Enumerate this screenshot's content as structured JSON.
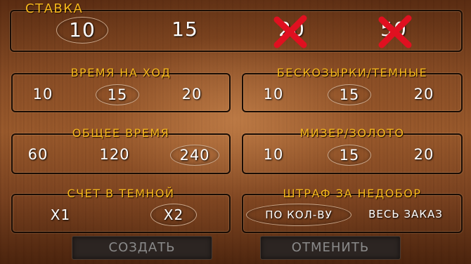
{
  "stake": {
    "title": "СТАВКА",
    "options": [
      "10",
      "15",
      "20",
      "50"
    ]
  },
  "move_time": {
    "title": "ВРЕМЯ НА ХОД",
    "options": [
      "10",
      "15",
      "20"
    ]
  },
  "no_trump_dark": {
    "title": "БЕСКОЗЫРКИ/ТЕМНЫЕ",
    "options": [
      "10",
      "15",
      "20"
    ]
  },
  "total_time": {
    "title": "ОБЩЕЕ ВРЕМЯ",
    "options": [
      "60",
      "120",
      "240"
    ]
  },
  "misere_gold": {
    "title": "МИЗЕР/ЗОЛОТО",
    "options": [
      "10",
      "15",
      "20"
    ]
  },
  "dark_score": {
    "title": "СЧЕТ В ТЕМНОЙ",
    "options": [
      "X1",
      "X2"
    ]
  },
  "penalty": {
    "title": "ШТРАФ ЗА НЕДОБОР",
    "options": [
      "ПО КОЛ-ВУ",
      "ВЕСЬ ЗАКАЗ"
    ]
  },
  "buttons": {
    "create": "СОЗДАТЬ",
    "cancel": "ОТМЕНИТЬ"
  },
  "colors": {
    "title": "#f5b81c",
    "disabled_cross": "#e01020",
    "selection_ring": "#c9a68a"
  }
}
